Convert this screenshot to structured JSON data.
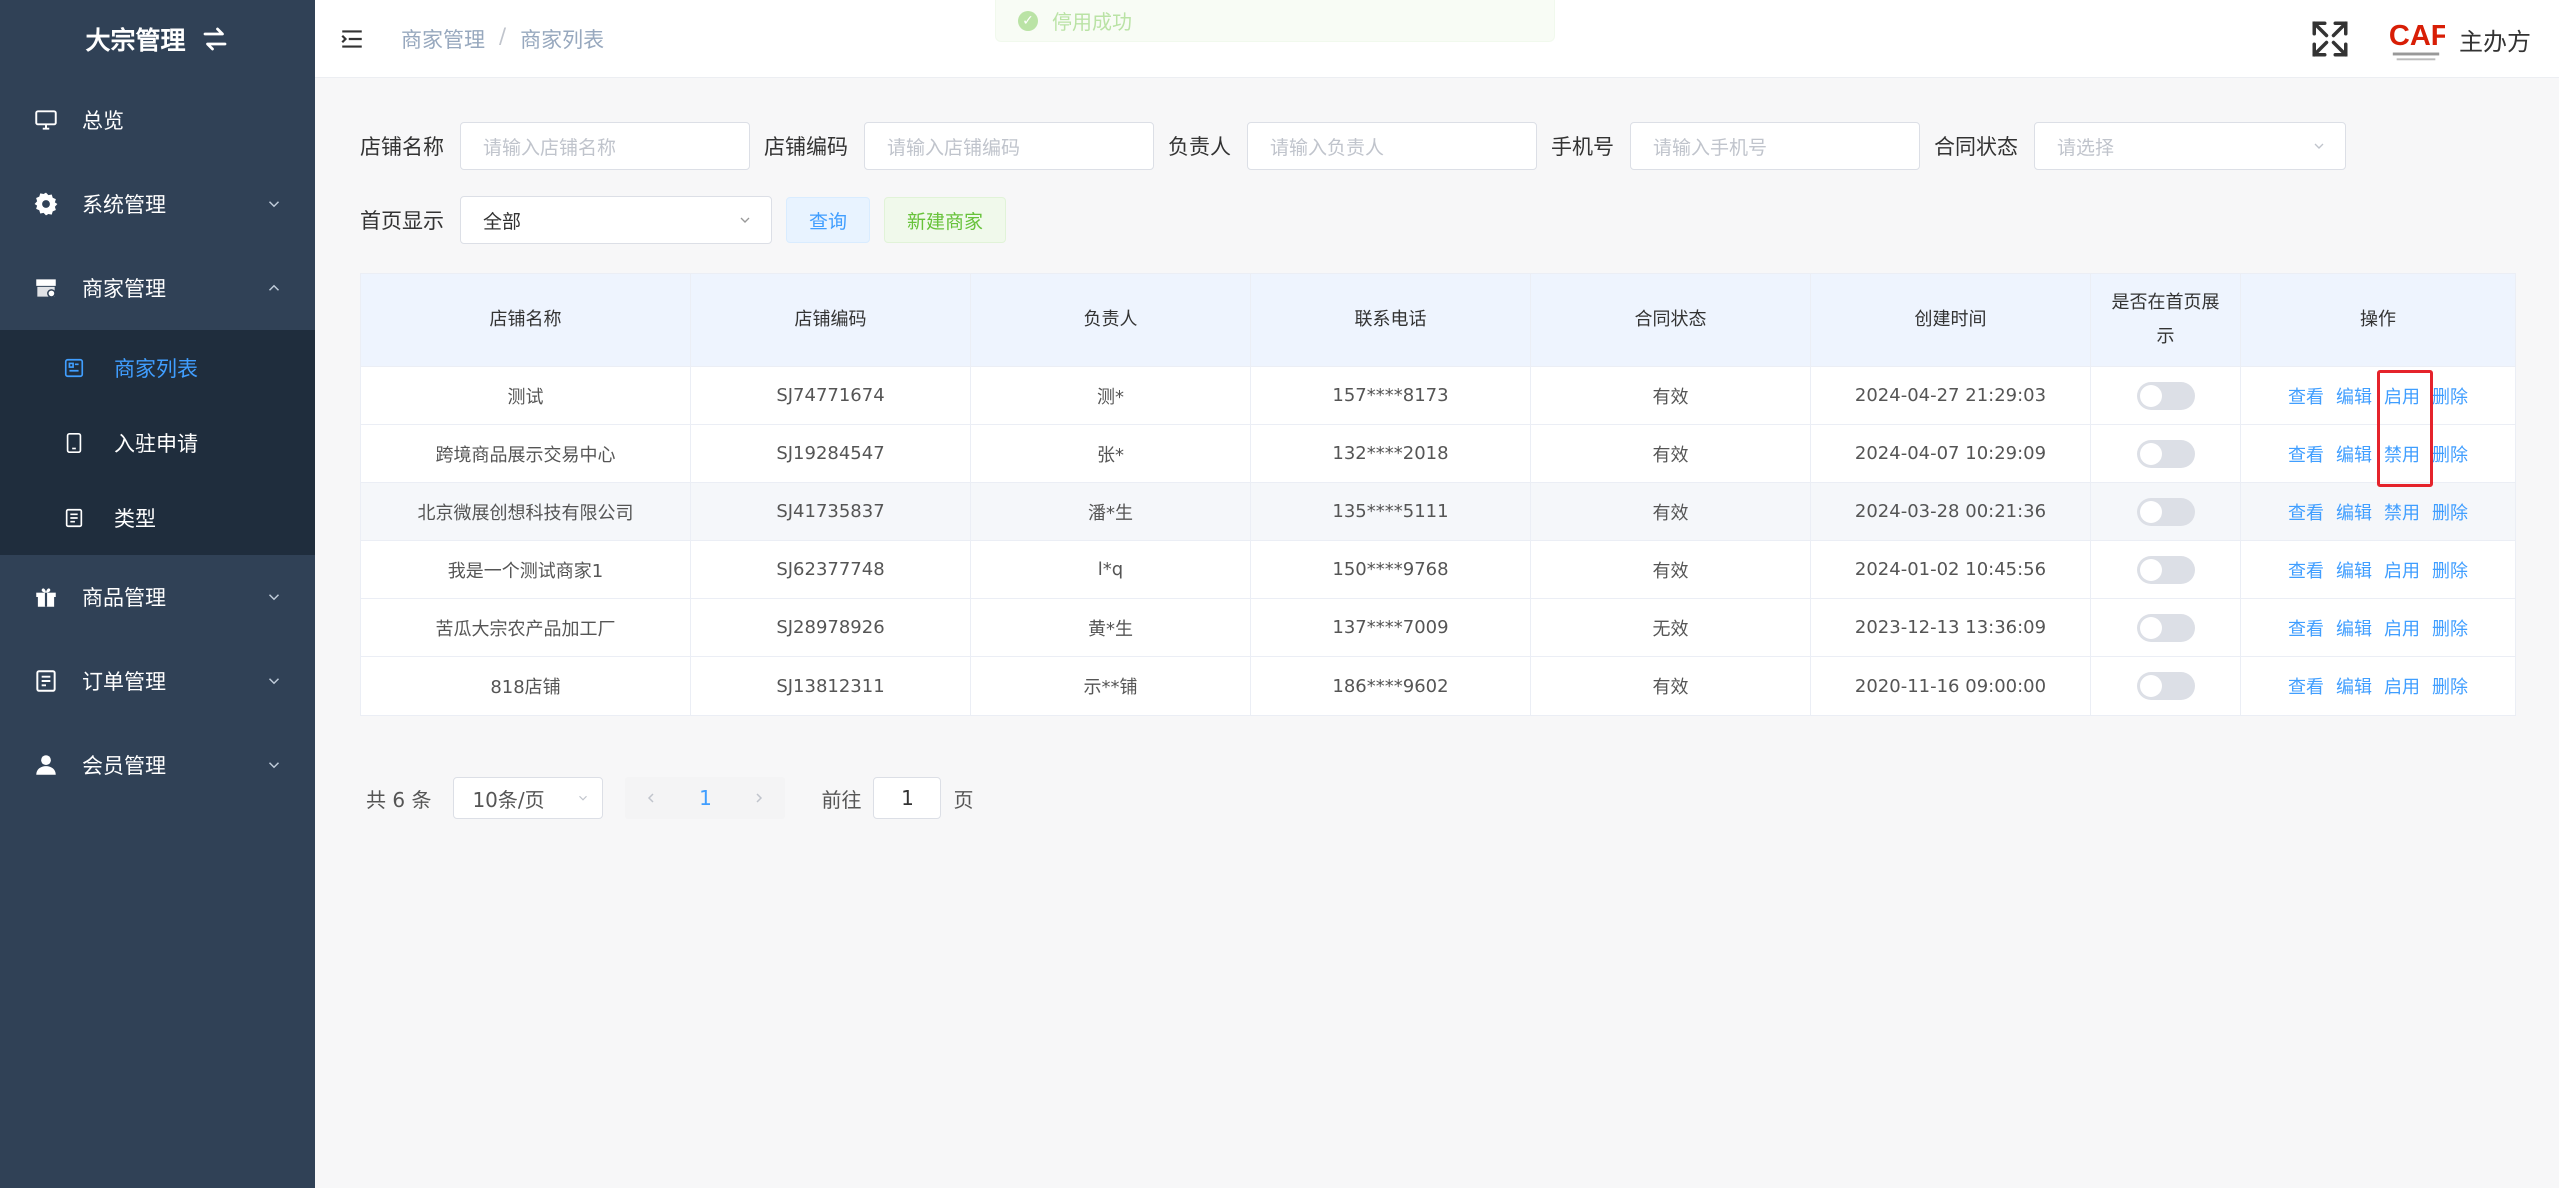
{
  "sidebar": {
    "brand": "大宗管理",
    "items": [
      {
        "label": "总览",
        "icon": "monitor-icon"
      },
      {
        "label": "系统管理",
        "icon": "gear-icon"
      },
      {
        "label": "商家管理",
        "icon": "shop-icon"
      },
      {
        "label": "商品管理",
        "icon": "gift-icon"
      },
      {
        "label": "订单管理",
        "icon": "order-icon"
      },
      {
        "label": "会员管理",
        "icon": "user-icon"
      }
    ],
    "merchant_sub": [
      {
        "label": "商家列表",
        "icon": "list-icon"
      },
      {
        "label": "入驻申请",
        "icon": "tablet-icon"
      },
      {
        "label": "类型",
        "icon": "document-icon"
      }
    ]
  },
  "header": {
    "breadcrumb": [
      "商家管理",
      "商家列表"
    ],
    "breadcrumb_sep": "/",
    "toast": "停用成功",
    "user": "主办方",
    "logo_text": "CAF"
  },
  "filters": {
    "store_name": {
      "label": "店铺名称",
      "placeholder": "请输入店铺名称"
    },
    "store_code": {
      "label": "店铺编码",
      "placeholder": "请输入店铺编码"
    },
    "owner": {
      "label": "负责人",
      "placeholder": "请输入负责人"
    },
    "phone": {
      "label": "手机号",
      "placeholder": "请输入手机号"
    },
    "contract": {
      "label": "合同状态",
      "placeholder": "请选择"
    },
    "homepage": {
      "label": "首页显示",
      "value": "全部"
    },
    "query_button": "查询",
    "new_button": "新建商家"
  },
  "table": {
    "columns": [
      "店铺名称",
      "店铺编码",
      "负责人",
      "联系电话",
      "合同状态",
      "创建时间",
      "是否在首页展示",
      "操作"
    ],
    "rows": [
      {
        "name": "测试",
        "code": "SJ74771674",
        "owner": "测*",
        "phone": "157****8173",
        "contract": "有效",
        "created": "2024-04-27 21:29:03",
        "toggle": "启用"
      },
      {
        "name": "跨境商品展示交易中心",
        "code": "SJ19284547",
        "owner": "张*",
        "phone": "132****2018",
        "contract": "有效",
        "created": "2024-04-07 10:29:09",
        "toggle": "禁用"
      },
      {
        "name": "北京微展创想科技有限公司",
        "code": "SJ41735837",
        "owner": "潘*生",
        "phone": "135****5111",
        "contract": "有效",
        "created": "2024-03-28 00:21:36",
        "toggle": "禁用"
      },
      {
        "name": "我是一个测试商家1",
        "code": "SJ62377748",
        "owner": "l*q",
        "phone": "150****9768",
        "contract": "有效",
        "created": "2024-01-02 10:45:56",
        "toggle": "启用"
      },
      {
        "name": "苦瓜大宗农产品加工厂",
        "code": "SJ28978926",
        "owner": "黄*生",
        "phone": "137****7009",
        "contract": "无效",
        "created": "2023-12-13 13:36:09",
        "toggle": "启用"
      },
      {
        "name": "818店铺",
        "code": "SJ13812311",
        "owner": "示**铺",
        "phone": "186****9602",
        "contract": "有效",
        "created": "2020-11-16 09:00:00",
        "toggle": "启用"
      }
    ],
    "actions": {
      "view": "查看",
      "edit": "编辑",
      "delete": "删除"
    }
  },
  "pagination": {
    "total": "共 6 条",
    "page_size": "10条/页",
    "current_page": "1",
    "goto_prefix": "前往",
    "goto_value": "1",
    "goto_suffix": "页"
  },
  "colors": {
    "sidebar_bg": "#304156",
    "submenu_bg": "#1f2d3d",
    "accent": "#409eff",
    "success": "#67c23a",
    "highlight_border": "#e5232b"
  }
}
